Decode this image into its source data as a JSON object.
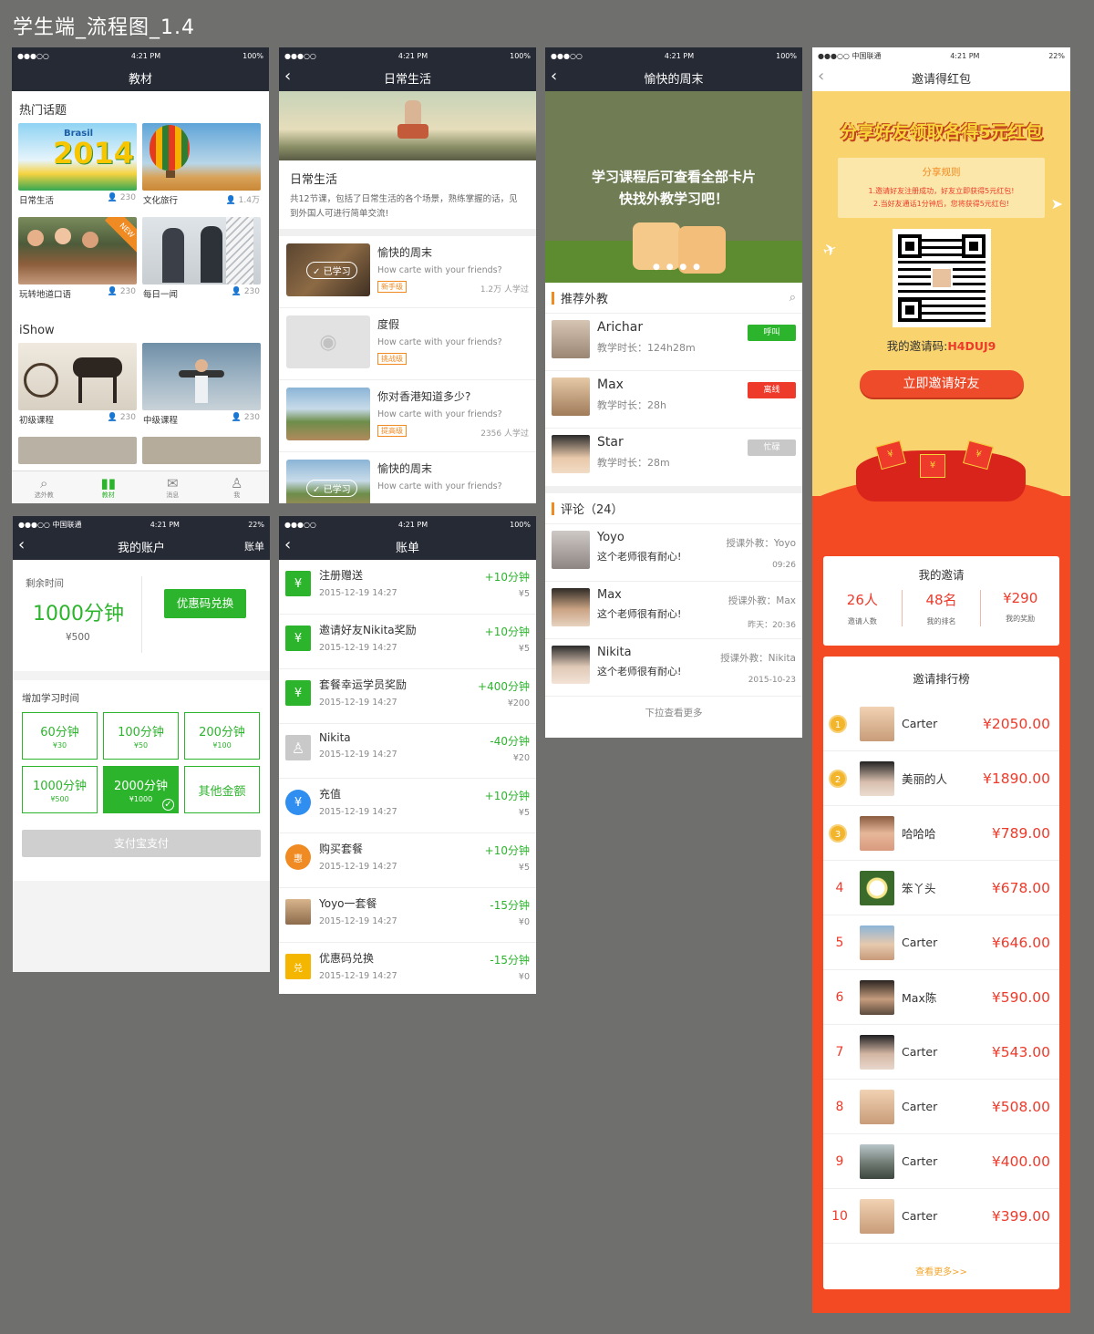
{
  "page_title": "学生端_流程图_1.4",
  "status": {
    "carrier_dots": "●●●○○",
    "time": "4:21 PM",
    "battery": "100%",
    "carrier2": "●●●○○ 中国联通",
    "battery2": "22%"
  },
  "s1": {
    "nav_title": "教材",
    "hot_label": "热门话题",
    "hot_items": [
      {
        "name": "日常生活",
        "count": "230"
      },
      {
        "name": "文化旅行",
        "count": "1.4万"
      },
      {
        "name": "玩转地道口语",
        "count": "230"
      },
      {
        "name": "每日一闻",
        "count": "230"
      }
    ],
    "thumb_text": {
      "brasil": "Brasil",
      "year": "2014",
      "new": "NEW"
    },
    "ishow_label": "iShow",
    "ishow_items": [
      {
        "name": "初级课程",
        "count": "230"
      },
      {
        "name": "中级课程",
        "count": "230"
      }
    ],
    "tabs": [
      "选外教",
      "教材",
      "消息",
      "我"
    ]
  },
  "s2": {
    "nav_title": "日常生活",
    "heading": "日常生活",
    "desc": "共12节课，包括了日常生活的各个场景，熟练掌握的话，见到外国人可进行简单交流!",
    "learned": "已学习",
    "lessons": [
      {
        "title": "愉快的周末",
        "sub": "How carte with your friends?",
        "badge": "新手级",
        "count": "1.2万 人学过"
      },
      {
        "title": "度假",
        "sub": "How carte with your friends?",
        "badge": "挑战级",
        "count": ""
      },
      {
        "title": "你对香港知道多少?",
        "sub": "How carte with your friends?",
        "badge": "提高级",
        "count": "2356 人学过"
      },
      {
        "title": "愉快的周末",
        "sub": "How carte with your friends?",
        "badge": "",
        "count": ""
      }
    ]
  },
  "s3": {
    "nav_title": "愉快的周末",
    "banner_line1": "学习课程后可查看全部卡片",
    "banner_line2": "快找外教学习吧！",
    "rec_label": "推荐外教",
    "teachers": [
      {
        "name": "Arichar",
        "time": "教学时长：124h28m",
        "status": "呼叫",
        "color": "#2db42d"
      },
      {
        "name": "Max",
        "time": "教学时长：28h",
        "status": "离线",
        "color": "#ee3a2a"
      },
      {
        "name": "Star",
        "time": "教学时长：28m",
        "status": "忙碌",
        "color": "#c8c8c8"
      }
    ],
    "comment_label": "评论（24）",
    "comments": [
      {
        "name": "Yoyo",
        "text": "这个老师很有耐心!",
        "teacher": "授课外教：Yoyo",
        "date": "09:26"
      },
      {
        "name": "Max",
        "text": "这个老师很有耐心!",
        "teacher": "授课外教：Max",
        "date": "昨天：20:36"
      },
      {
        "name": "Nikita",
        "text": "这个老师很有耐心!",
        "teacher": "授课外教：Nikita",
        "date": "2015-10-23"
      }
    ],
    "more": "下拉查看更多"
  },
  "s4": {
    "nav_title": "邀请得红包",
    "banner": "分享好友领取各得5元红包",
    "rules_title": "分享规则",
    "rule1": "1.邀请好友注册成功，好友立即获得5元红包!",
    "rule2": "2.当好友通话1分钟后，您将获得5元红包!",
    "code_label": "我的邀请码:",
    "code": "H4DUJ9",
    "invite_btn": "立即邀请好友",
    "my_invite": "我的邀请",
    "stats": [
      {
        "value": "26人",
        "label": "邀请人数"
      },
      {
        "value": "48名",
        "label": "我的排名"
      },
      {
        "value": "¥290",
        "label": "我的奖励"
      }
    ],
    "rank_title": "邀请排行榜",
    "ranks": [
      {
        "rank": "1",
        "name": "Carter",
        "amount": "¥2050.00"
      },
      {
        "rank": "2",
        "name": "美丽的人",
        "amount": "¥1890.00"
      },
      {
        "rank": "3",
        "name": "哈哈哈",
        "amount": "¥789.00"
      },
      {
        "rank": "4",
        "name": "笨丫头",
        "amount": "¥678.00"
      },
      {
        "rank": "5",
        "name": "Carter",
        "amount": "¥646.00"
      },
      {
        "rank": "6",
        "name": "Max陈",
        "amount": "¥590.00"
      },
      {
        "rank": "7",
        "name": "Carter",
        "amount": "¥543.00"
      },
      {
        "rank": "8",
        "name": "Carter",
        "amount": "¥508.00"
      },
      {
        "rank": "9",
        "name": "Carter",
        "amount": "¥400.00"
      },
      {
        "rank": "10",
        "name": "Carter",
        "amount": "¥399.00"
      }
    ],
    "view_more": "查看更多>>"
  },
  "s5": {
    "nav_title": "我的账户",
    "nav_right": "账单",
    "remain_label": "剩余时间",
    "remain_value": "1000分钟",
    "remain_money": "¥500",
    "coupon_btn": "优惠码兑换",
    "add_label": "增加学习时间",
    "packages": [
      {
        "a": "60分钟",
        "b": "¥30"
      },
      {
        "a": "100分钟",
        "b": "¥50"
      },
      {
        "a": "200分钟",
        "b": "¥100"
      },
      {
        "a": "1000分钟",
        "b": "¥500"
      },
      {
        "a": "2000分钟",
        "b": "¥1000"
      },
      {
        "a": "其他金额",
        "b": ""
      }
    ],
    "pay_btn": "支付宝支付"
  },
  "s6": {
    "nav_title": "账单",
    "bills": [
      {
        "name": "注册赠送",
        "date": "2015-12-19   14:27",
        "amount": "+10分钟",
        "price": "¥5",
        "icon": "¥",
        "color": "#2db42d"
      },
      {
        "name": "邀请好友Nikita奖励",
        "date": "2015-12-19   14:27",
        "amount": "+10分钟",
        "price": "¥5",
        "icon": "¥",
        "color": "#2db42d"
      },
      {
        "name": "套餐幸运学员奖励",
        "date": "2015-12-19   14:27",
        "amount": "+400分钟",
        "price": "¥200",
        "icon": "¥",
        "color": "#2db42d"
      },
      {
        "name": "Nikita",
        "date": "2015-12-19   14:27",
        "amount": "-40分钟",
        "price": "¥20",
        "icon": "",
        "color": "#c9c9c9"
      },
      {
        "name": "充值",
        "date": "2015-12-19   14:27",
        "amount": "+10分钟",
        "price": "¥5",
        "icon": "¥",
        "color": "#2f8ef0"
      },
      {
        "name": "购买套餐",
        "date": "2015-12-19   14:27",
        "amount": "+10分钟",
        "price": "¥5",
        "icon": "惠",
        "color": "#f08a22"
      },
      {
        "name": "Yoyo一套餐",
        "date": "2015-12-19   14:27",
        "amount": "-15分钟",
        "price": "¥0",
        "icon": "",
        "color": "#b9a58a"
      },
      {
        "name": "优惠码兑换",
        "date": "2015-12-19   14:27",
        "amount": "-15分钟",
        "price": "¥0",
        "icon": "兑",
        "color": "#f4b600"
      }
    ]
  }
}
